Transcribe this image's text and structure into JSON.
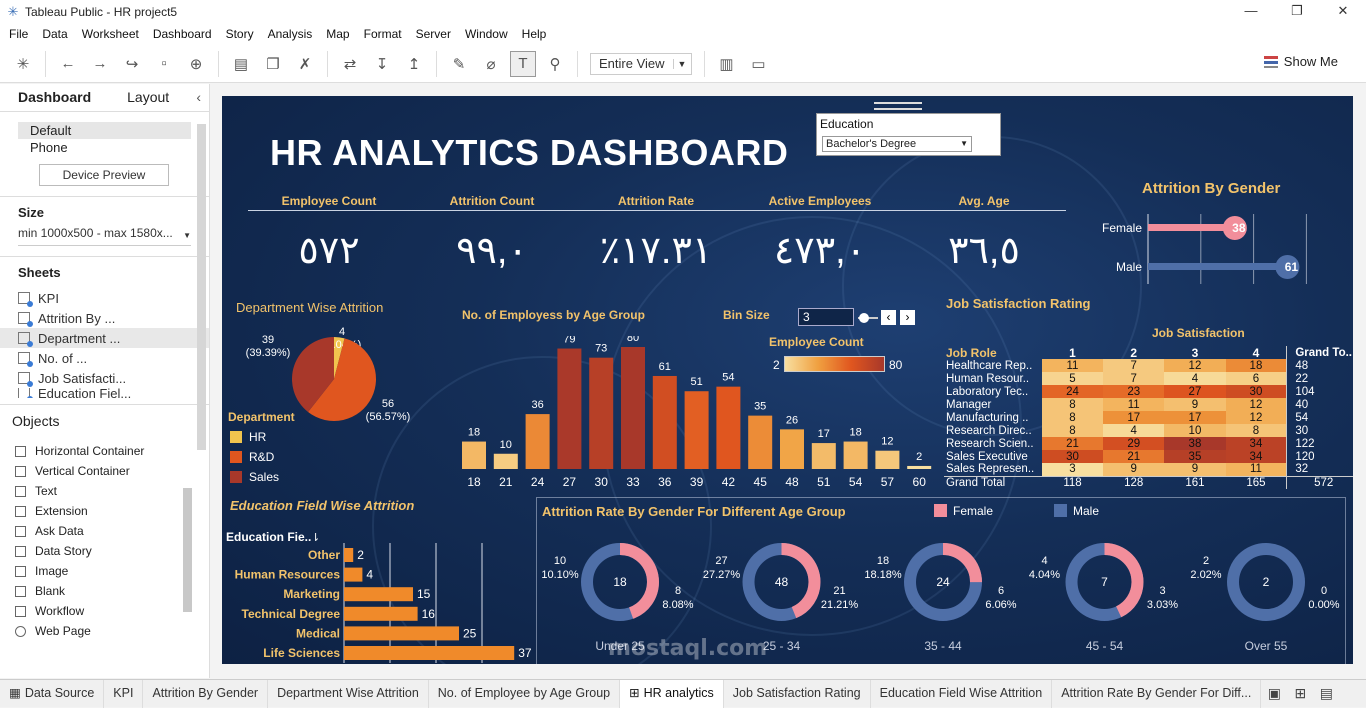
{
  "window": {
    "title": "Tableau Public - HR project5",
    "controls": [
      "—",
      "❐",
      "✕"
    ]
  },
  "menu": [
    "File",
    "Data",
    "Worksheet",
    "Dashboard",
    "Story",
    "Analysis",
    "Map",
    "Format",
    "Server",
    "Window",
    "Help"
  ],
  "toolbar": {
    "view_mode": "Entire View",
    "show_me": "Show Me"
  },
  "left_panel": {
    "tabs": [
      "Dashboard",
      "Layout"
    ],
    "device_items": [
      "Default",
      "Phone"
    ],
    "device_preview": "Device Preview",
    "size_label": "Size",
    "size_value": "min 1000x500 - max 1580x...",
    "sheets_label": "Sheets",
    "sheets": [
      "KPI",
      "Attrition By ...",
      "Department ...",
      "No. of ...",
      "Job Satisfacti...",
      "Education Fiel..."
    ],
    "objects_label": "Objects",
    "objects": [
      "Horizontal Container",
      "Vertical Container",
      "Text",
      "Extension",
      "Ask Data",
      "Data Story",
      "Image",
      "Blank",
      "Workflow",
      "Web Page"
    ]
  },
  "dashboard": {
    "title": "HR ANALYTICS DASHBOARD",
    "filter": {
      "label": "Education",
      "value": "Bachelor's Degree"
    },
    "kpis": [
      {
        "label": "Employee Count",
        "value": "٥٧٢"
      },
      {
        "label": "Attrition Count",
        "value": "٩٩,٠"
      },
      {
        "label": "Attrition Rate",
        "value": "٪١٧.٣١"
      },
      {
        "label": "Active Employees",
        "value": "٤٧٣,٠"
      },
      {
        "label": "Avg. Age",
        "value": "٣٦,٥"
      }
    ],
    "gender_section": {
      "title": "Attrition By Gender"
    },
    "dept_section": {
      "title": "Department Wise Attrition",
      "legend_title": "Department"
    },
    "age_section": {
      "title": "No. of Employess by Age Group",
      "bin_label": "Bin Size",
      "bin_value": "3",
      "color_legend": "Employee Count",
      "color_min": "2",
      "color_max": "80"
    },
    "job_section": {
      "title": "Job Satisfaction Rating",
      "col_title": "Job Satisfaction",
      "row_header": "Job Role",
      "grand_total_col": "Grand To..",
      "grand_total_row": "Grand Total"
    },
    "edu_section": {
      "title": "Education Field Wise Attrition",
      "axis_label": "Education Fie.."
    },
    "donut_section": {
      "title": "Attrition Rate By Gender For Different Age Group",
      "legend": [
        "Female",
        "Male"
      ]
    }
  },
  "chart_data": [
    {
      "type": "bar",
      "title": "Attrition By Gender",
      "categories": [
        "Female",
        "Male"
      ],
      "values": [
        38,
        61
      ],
      "colors": [
        "#f28e9b",
        "#4f6fa8"
      ]
    },
    {
      "type": "pie",
      "title": "Department Wise Attrition",
      "slices": [
        {
          "name": "HR",
          "value": 4,
          "label": "4\n(4.04%)",
          "color": "#f1c44e"
        },
        {
          "name": "R&D",
          "value": 56,
          "label": "56\n(56.57%)",
          "color": "#e0561f"
        },
        {
          "name": "Sales",
          "value": 39,
          "label": "39\n(39.39%)",
          "color": "#a8382a"
        }
      ]
    },
    {
      "type": "bar",
      "title": "No. of Employess by Age Group",
      "categories": [
        "18",
        "21",
        "24",
        "27",
        "30",
        "33",
        "36",
        "39",
        "42",
        "45",
        "48",
        "51",
        "54",
        "57",
        "60"
      ],
      "values": [
        18,
        10,
        36,
        79,
        73,
        80,
        61,
        51,
        54,
        35,
        26,
        17,
        18,
        12,
        2
      ]
    },
    {
      "type": "heatmap",
      "title": "Job Satisfaction Rating",
      "columns": [
        "1",
        "2",
        "3",
        "4"
      ],
      "rows": [
        {
          "role": "Healthcare Rep..",
          "values": [
            11,
            7,
            12,
            18
          ],
          "total": 48
        },
        {
          "role": "Human Resour..",
          "values": [
            5,
            7,
            4,
            6
          ],
          "total": 22
        },
        {
          "role": "Laboratory Tec..",
          "values": [
            24,
            23,
            27,
            30
          ],
          "total": 104
        },
        {
          "role": "Manager",
          "values": [
            8,
            11,
            9,
            12
          ],
          "total": 40
        },
        {
          "role": "Manufacturing ..",
          "values": [
            8,
            17,
            17,
            12
          ],
          "total": 54
        },
        {
          "role": "Research Direc..",
          "values": [
            8,
            4,
            10,
            8
          ],
          "total": 30
        },
        {
          "role": "Research Scien..",
          "values": [
            21,
            29,
            38,
            34
          ],
          "total": 122
        },
        {
          "role": "Sales Executive",
          "values": [
            30,
            21,
            35,
            34
          ],
          "total": 120
        },
        {
          "role": "Sales Represen..",
          "values": [
            3,
            9,
            9,
            11
          ],
          "total": 32
        }
      ],
      "grand_total": [
        118,
        128,
        161,
        165
      ],
      "grand_total_all": 572
    },
    {
      "type": "bar",
      "title": "Education Field Wise Attrition",
      "categories": [
        "Other",
        "Human Resources",
        "Marketing",
        "Technical Degree",
        "Medical",
        "Life Sciences"
      ],
      "values": [
        2,
        4,
        15,
        16,
        25,
        37
      ]
    },
    {
      "type": "pie",
      "title": "Attrition Rate By Gender For Different Age Group",
      "groups": [
        {
          "name": "Under 25",
          "total": "18",
          "female": "8",
          "female_pct": "8.08%",
          "male": "10",
          "male_pct": "10.10%"
        },
        {
          "name": "25 - 34",
          "total": "48",
          "female": "21",
          "female_pct": "21.21%",
          "male": "27",
          "male_pct": "27.27%"
        },
        {
          "name": "35 - 44",
          "total": "24",
          "female": "6",
          "female_pct": "6.06%",
          "male": "18",
          "male_pct": "18.18%"
        },
        {
          "name": "45 - 54",
          "total": "7",
          "female": "3",
          "female_pct": "3.03%",
          "male": "4",
          "male_pct": "4.04%"
        },
        {
          "name": "Over 55",
          "total": "2",
          "female": "0",
          "female_pct": "0.00%",
          "male": "2",
          "male_pct": "2.02%"
        }
      ]
    }
  ],
  "watermark": "mostaql.com",
  "bottom_tabs": [
    "Data Source",
    "KPI",
    "Attrition By Gender",
    "Department Wise Attrition",
    "No. of Employee by Age Group",
    "HR analytics",
    "Job Satisfaction Rating",
    "Education Field Wise Attrition",
    "Attrition Rate By Gender For Diff..."
  ]
}
